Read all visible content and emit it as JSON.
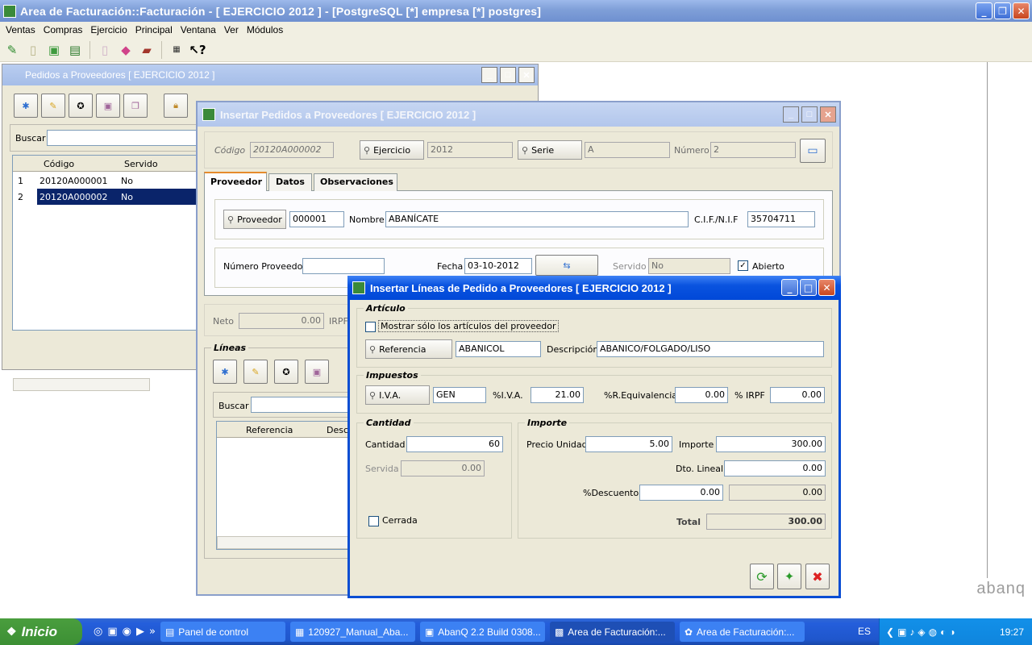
{
  "main_window": {
    "title": "Area de Facturación::Facturación  - [ EJERCICIO 2012 ] - [PostgreSQL [*] empresa [*] postgres]",
    "buttons": {
      "minimize": "_",
      "restore": "❐",
      "close": "✕"
    }
  },
  "menu": [
    "Ventas",
    "Compras",
    "Ejercicio",
    "Principal",
    "Ventana",
    "Ver",
    "Módulos"
  ],
  "toolbar_icons": [
    "sales-icon",
    "document-icon",
    "package-icon",
    "invoice-icon",
    "page-icon",
    "box-icon",
    "bag-icon",
    "calendar-icon",
    "help-icon"
  ],
  "pedidos_window": {
    "title": "Pedidos a Proveedores [ EJERCICIO 2012 ]",
    "search_label": "Buscar",
    "columns": [
      "Código",
      "Servido"
    ],
    "rows": [
      {
        "num": "1",
        "codigo": "20120A000001",
        "servido": "No"
      },
      {
        "num": "2",
        "codigo": "20120A000002",
        "servido": "No"
      }
    ]
  },
  "insert_pedido": {
    "title": "Insertar Pedidos a Proveedores [ EJERCICIO 2012 ]",
    "codigo_label": "Código",
    "codigo": "20120A000002",
    "ejercicio_btn": "Ejercicio",
    "ejercicio": "2012",
    "serie_btn": "Serie",
    "serie": "A",
    "numero_label": "Número",
    "numero": "2",
    "tabs": [
      "Proveedor",
      "Datos",
      "Observaciones"
    ],
    "proveedor_btn": "Proveedor",
    "proveedor": "000001",
    "nombre_label": "Nombre",
    "nombre": "ABANÍCATE",
    "cif_label": "C.I.F./N.I.F",
    "cif": "35704711",
    "num_proveedor_label": "Número Proveedor",
    "num_proveedor": "",
    "fecha_label": "Fecha",
    "fecha": "03-10-2012",
    "servido_label": "Servido",
    "servido": "No",
    "abierto_label": "Abierto",
    "neto_label": "Neto",
    "neto": "0.00",
    "irpf_label": "IRPF",
    "lineas_label": "Líneas",
    "lineas_search": "Buscar",
    "lineas_columns": [
      "Referencia",
      "Descr"
    ]
  },
  "insert_linea": {
    "title": "Insertar Líneas de Pedido a Proveedores [ EJERCICIO 2012 ]",
    "articulo_group": "Artículo",
    "mostrar_label": "Mostrar sólo los artículos del proveedor",
    "referencia_btn": "Referencia",
    "referencia": "ABANICOL",
    "descripcion_label": "Descripción",
    "descripcion": "ABANICO/FOLGADO/LISO",
    "impuestos_group": "Impuestos",
    "iva_btn": "I.V.A.",
    "iva_code": "GEN",
    "pct_iva_label": "%I.V.A.",
    "pct_iva": "21.00",
    "req_label": "%R.Equivalencia",
    "req": "0.00",
    "irpf_label": "% IRPF",
    "irpf": "0.00",
    "cantidad_group": "Cantidad",
    "cantidad_label": "Cantidad",
    "cantidad": "60",
    "servida_label": "Servida",
    "servida": "0.00",
    "cerrada_label": "Cerrada",
    "importe_group": "Importe",
    "precio_label": "Precio Unidad",
    "precio": "5.00",
    "importe_label": "Importe",
    "importe": "300.00",
    "dto_lineal_label": "Dto. Lineal",
    "dto_lineal": "0.00",
    "descuento_label": "%Descuento",
    "descuento": "0.00",
    "descuento_importe": "0.00",
    "total_label": "Total",
    "total": "300.00"
  },
  "watermark": "abanq",
  "taskbar": {
    "start": "Inicio",
    "tasks": [
      {
        "label": "Panel de control",
        "icon": "folder-icon"
      },
      {
        "label": "120927_Manual_Aba...",
        "icon": "doc-icon"
      },
      {
        "label": "AbanQ 2.2 Build 0308...",
        "icon": "abanq-icon"
      },
      {
        "label": "Area de Facturación:...",
        "icon": "app-icon"
      },
      {
        "label": "Area de Facturación:...",
        "icon": "app-icon"
      }
    ],
    "lang": "ES",
    "clock": "19:27"
  }
}
